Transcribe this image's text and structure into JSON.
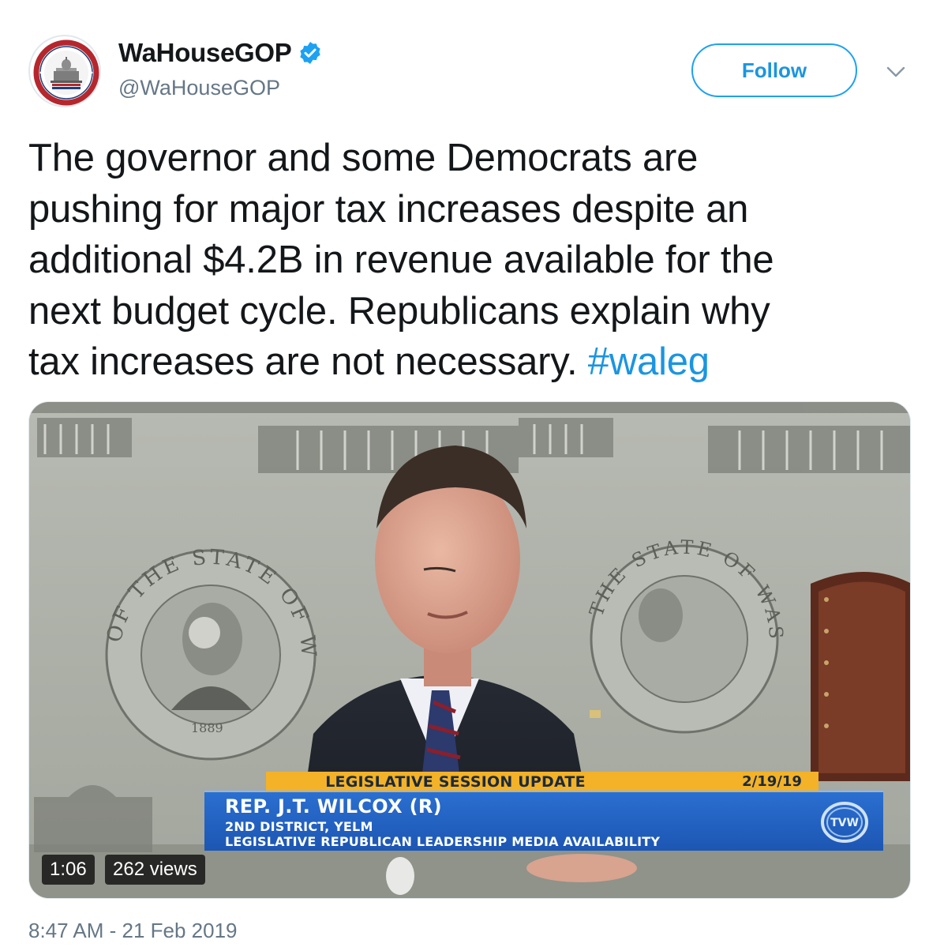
{
  "user": {
    "display_name": "WaHouseGOP",
    "handle": "@WaHouseGOP",
    "avatar_icon": "washington-house-republicans-seal",
    "avatar_seal_text_top": "WASHINGTON STATE",
    "avatar_seal_text_bottom": "HOUSE REPUBLICANS",
    "verified_icon": "verified-badge-icon"
  },
  "follow_label": "Follow",
  "tweet": {
    "text_line_1": "The governor and some Democrats are",
    "text_line_2": "pushing for major tax increases despite an",
    "text_line_3": "additional $4.2B in revenue available for the",
    "text_line_4": "next budget cycle. Republicans explain why",
    "text_line_5": "tax increases are not necessary. ",
    "hashtag": "#waleg"
  },
  "video": {
    "banner_title": "LEGISLATIVE SESSION UPDATE",
    "banner_date": "2/19/19",
    "rep_name": "REP. J.T. WILCOX (R)",
    "district": "2ND DISTRICT, YELM",
    "event": "LEGISLATIVE REPUBLICAN LEADERSHIP MEDIA AVAILABILITY",
    "network_logo": "TVW",
    "seal_text_left": "THE SEAL OF THE STATE OF WASHINGTON",
    "seal_year": "1889",
    "duration": "1:06",
    "views": "262 views"
  },
  "timestamp": "8:47 AM - 21 Feb 2019",
  "colors": {
    "link": "#1b95e0",
    "follow_border": "#1da1f2",
    "secondary_text": "#657786",
    "banner_gold": "#f3b227",
    "banner_blue": "#1d56b3"
  }
}
